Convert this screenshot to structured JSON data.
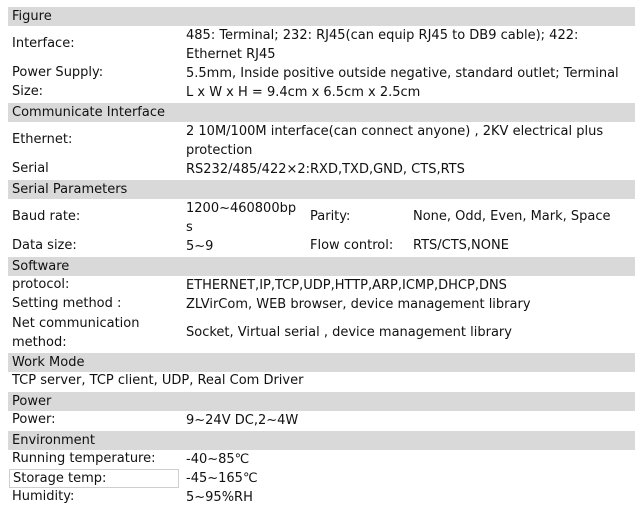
{
  "sections": {
    "figure": {
      "title": "Figure",
      "interface_label": "Interface:",
      "interface_value": "485: Terminal; 232: RJ45(can equip RJ45 to DB9 cable); 422: Ethernet RJ45",
      "power_supply_label": "Power Supply:",
      "power_supply_value": "5.5mm, Inside positive outside negative, standard outlet; Terminal",
      "size_label": "Size:",
      "size_value": "L x W x H = 9.4cm x 6.5cm x 2.5cm"
    },
    "communicate": {
      "title": "Communicate Interface",
      "ethernet_label": "Ethernet:",
      "ethernet_value": "2 10M/100M interface(can connect anyone) , 2KV electrical plus protection",
      "serial_label": "Serial",
      "serial_value": "RS232/485/422×2:RXD,TXD,GND, CTS,RTS"
    },
    "serial_params": {
      "title": "Serial Parameters",
      "baud_label": "Baud rate:",
      "baud_value": "1200~460800bps",
      "parity_label": "Parity:",
      "parity_value": "None, Odd, Even, Mark, Space",
      "data_size_label": "Data size:",
      "data_size_value": "5~9",
      "flow_label": "Flow control:",
      "flow_value": "RTS/CTS,NONE"
    },
    "software": {
      "title": "Software",
      "protocol_label": "protocol:",
      "protocol_value": "ETHERNET,IP,TCP,UDP,HTTP,ARP,ICMP,DHCP,DNS",
      "setting_label": "Setting method :",
      "setting_value": "ZLVirCom, WEB browser, device management library",
      "net_label": "Net communication method:",
      "net_value": "Socket, Virtual serial , device management library"
    },
    "work_mode": {
      "title": "Work Mode",
      "value": "TCP server, TCP client, UDP, Real Com Driver"
    },
    "power": {
      "title": "Power",
      "power_label": "Power:",
      "power_value": "9~24V DC,2~4W"
    },
    "environment": {
      "title": "Environment",
      "running_label": "Running temperature:",
      "running_value": "-40~85℃",
      "storage_label": "Storage temp:",
      "storage_value": "-45~165℃",
      "humidity_label": "Humidity:",
      "humidity_value": "5~95%RH"
    }
  }
}
